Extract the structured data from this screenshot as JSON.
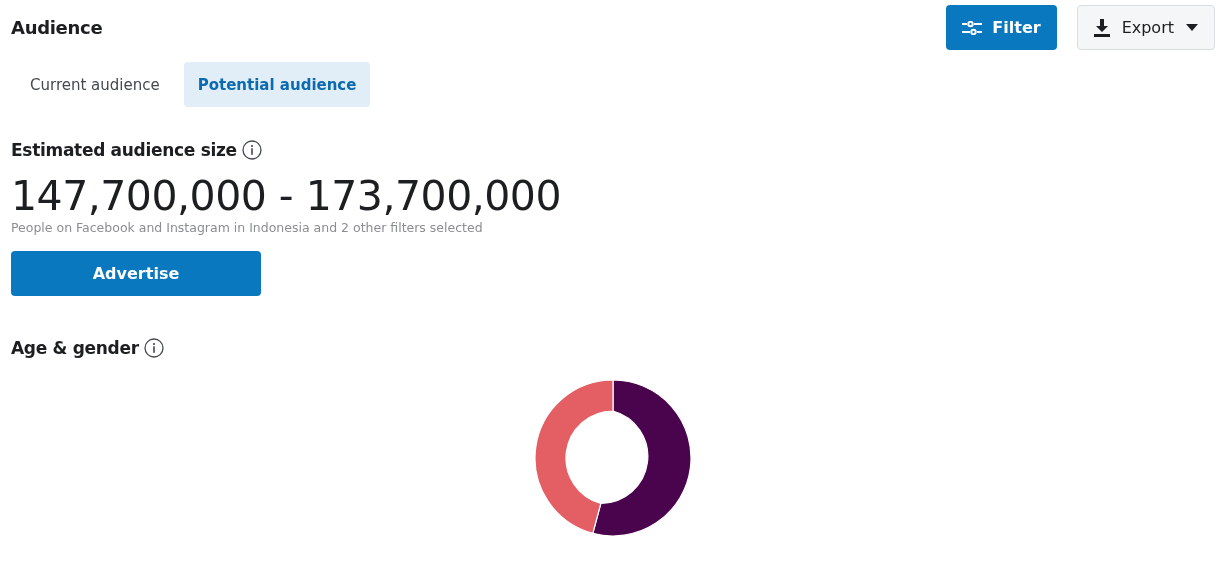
{
  "header": {
    "title": "Audience",
    "buttons": [
      {
        "kind": "filter",
        "label": "Filter"
      },
      {
        "kind": "export",
        "label": "Export"
      }
    ]
  },
  "tabs": [
    {
      "label": "Current audience",
      "selected": false
    },
    {
      "label": "Potential audience",
      "selected": true
    }
  ],
  "estimate": {
    "title": "Estimated audience size",
    "range": "147,700,000 - 173,700,000",
    "note": "People on Facebook and Instagram in Indonesia and 2 other filters selected",
    "button": "Advertise"
  },
  "age_gender": {
    "title": "Age & gender"
  }
}
